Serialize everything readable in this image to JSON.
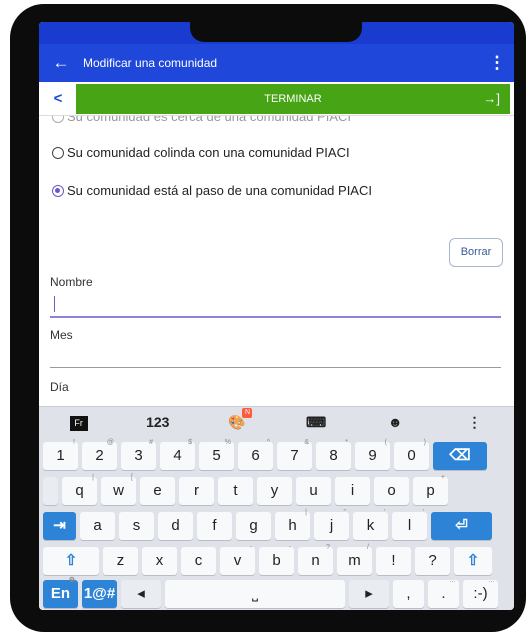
{
  "app_bar": {
    "back_icon": "arrow-left-icon",
    "title": "Modificar una comunidad",
    "menu_icon": "more-vert-icon"
  },
  "nav": {
    "prev_label": "<",
    "finish_label": "TERMINAR",
    "finish_icon": "→]"
  },
  "form": {
    "options": [
      {
        "label": "Su comunidad es cerca de una comunidad PIACI",
        "selected": false
      },
      {
        "label": "Su comunidad colinda con una comunidad PIACI",
        "selected": false
      },
      {
        "label": "Su comunidad está al paso de una comunidad PIACI",
        "selected": true
      }
    ],
    "clear_label": "Borrar",
    "fields": [
      {
        "label": "Nombre",
        "value": ""
      },
      {
        "label": "Mes",
        "value": ""
      },
      {
        "label": "Día",
        "value": ""
      }
    ]
  },
  "keyboard": {
    "toolbar": {
      "lang_badge": "Fr",
      "numbers_label": "123",
      "theme_badge": "N",
      "emoji_glyph": "☻",
      "more_glyph": "⋮"
    },
    "rows": [
      [
        {
          "k": "1",
          "h": "!"
        },
        {
          "k": "2",
          "h": "@"
        },
        {
          "k": "3",
          "h": "#"
        },
        {
          "k": "4",
          "h": "$"
        },
        {
          "k": "5",
          "h": "%"
        },
        {
          "k": "6",
          "h": "^"
        },
        {
          "k": "7",
          "h": "&"
        },
        {
          "k": "8",
          "h": "*"
        },
        {
          "k": "9",
          "h": "("
        },
        {
          "k": "0",
          "h": ")"
        }
      ],
      [
        {
          "k": "q",
          "h": "|"
        },
        {
          "k": "w",
          "h": "["
        },
        {
          "k": "e",
          "h": ""
        },
        {
          "k": "r",
          "h": ""
        },
        {
          "k": "t",
          "h": ""
        },
        {
          "k": "y",
          "h": ""
        },
        {
          "k": "u",
          "h": ""
        },
        {
          "k": "i",
          "h": ""
        },
        {
          "k": "o",
          "h": ""
        },
        {
          "k": "p",
          "h": "+"
        }
      ],
      [
        {
          "k": "a",
          "h": ""
        },
        {
          "k": "s",
          "h": ""
        },
        {
          "k": "d",
          "h": ""
        },
        {
          "k": "f",
          "h": ""
        },
        {
          "k": "g",
          "h": ""
        },
        {
          "k": "h",
          "h": "|"
        },
        {
          "k": "j",
          "h": "\""
        },
        {
          "k": "k",
          "h": "'"
        },
        {
          "k": "l",
          "h": "'"
        }
      ],
      [
        {
          "k": "z",
          "h": ""
        },
        {
          "k": "x",
          "h": ""
        },
        {
          "k": "c",
          "h": ""
        },
        {
          "k": "v",
          "h": "-"
        },
        {
          "k": "b",
          "h": "-"
        },
        {
          "k": "n",
          "h": "?"
        },
        {
          "k": "m",
          "h": "/"
        },
        {
          "k": "!",
          "h": ""
        },
        {
          "k": "?",
          "h": ""
        }
      ]
    ],
    "backspace_glyph": "⌫",
    "tab_glyph": "⇥",
    "enter_glyph": "⏎",
    "shift_glyph": "⇧",
    "lang_key": "En",
    "sym_key": "1@#",
    "cursor_left": "◂",
    "space_glyph": "⎵",
    "cursor_right": "▸",
    "comma_key": ",",
    "period_key": ".",
    "smiley_key": ":-)"
  }
}
